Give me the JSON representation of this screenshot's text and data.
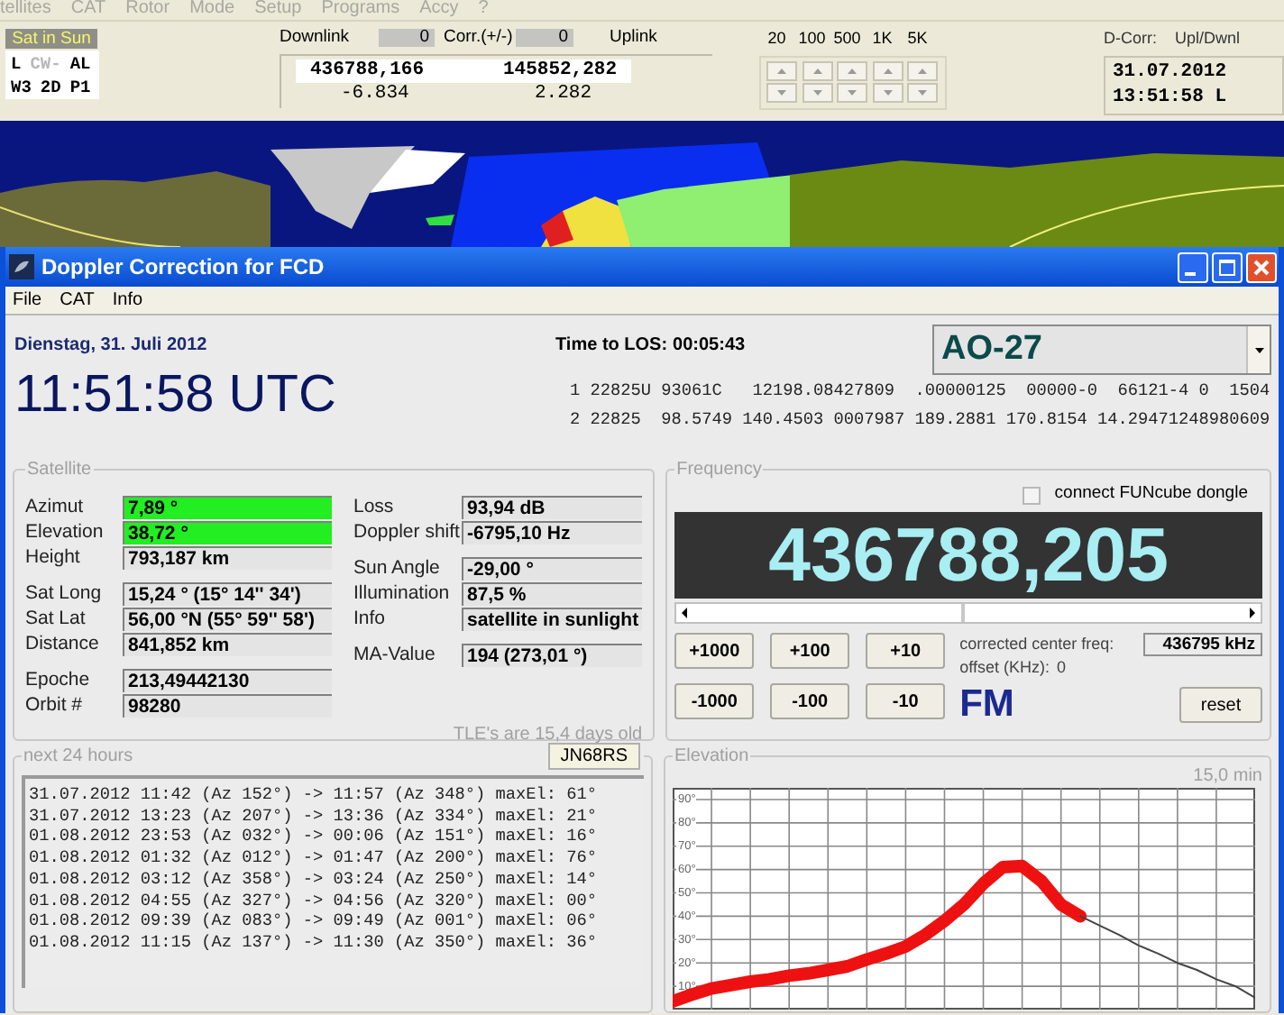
{
  "main_menu": [
    "tellites",
    "CAT",
    "Rotor",
    "Mode",
    "Setup",
    "Programs",
    "Accy",
    "?"
  ],
  "status_indicator": "Sat in Sun",
  "mode_flags": [
    [
      {
        "label": "L",
        "disabled": false
      },
      {
        "label": "CW-",
        "disabled": true
      },
      {
        "label": "AL",
        "disabled": false
      }
    ],
    [
      {
        "label": "W3",
        "disabled": false
      },
      {
        "label": "2D",
        "disabled": false
      },
      {
        "label": "P1",
        "disabled": false
      }
    ]
  ],
  "doppler_header": {
    "downlink_label": "Downlink",
    "downlink_value": "0",
    "corr_label": "Corr.(+/-)",
    "corr_value": "0",
    "uplink_label": "Uplink",
    "downlink_freq": "436788,166",
    "uplink_freq": "145852,282",
    "downlink_shift": "-6.834",
    "uplink_shift": "2.282"
  },
  "step_sizes": [
    "20",
    "100",
    "500",
    "1K",
    "5K"
  ],
  "clock": {
    "label": "D-Corr:",
    "mode": "Upl/Dwnl",
    "date": "31.07.2012",
    "time": "13:51:58 L"
  },
  "window": {
    "title": "Doppler Correction for FCD",
    "menu": [
      "File",
      "CAT",
      "Info"
    ],
    "date": "Dienstag, 31. Juli 2012",
    "time_utc": "11:51:58 UTC",
    "los_label": "Time to LOS:",
    "los": "00:05:43",
    "satellite_select": "AO-27",
    "tle_lines": [
      "1 22825U 93061C   12198.08427809  .00000125  00000-0  66121-4 0  1504",
      "2 22825  98.5749 140.4503 0007987 189.2881 170.8154 14.29471248980609"
    ]
  },
  "satellite": {
    "title": "Satellite",
    "left": [
      [
        {
          "label": "Azimut",
          "value": "7,89 °",
          "highlight": true
        },
        {
          "label": "Elevation",
          "value": "38,72 °",
          "highlight": true
        },
        {
          "label": "Height",
          "value": "793,187 km",
          "highlight": false
        }
      ],
      [
        {
          "label": "Sat Long",
          "value": "15,24 °  (15° 14'' 34')",
          "highlight": false
        },
        {
          "label": "Sat Lat",
          "value": "56,00 °N  (55° 59'' 58')",
          "highlight": false
        },
        {
          "label": "Distance",
          "value": "841,852 km",
          "highlight": false
        }
      ],
      [
        {
          "label": "Epoche",
          "value": "213,49442130",
          "highlight": false
        },
        {
          "label": "Orbit #",
          "value": "98280",
          "highlight": false
        }
      ]
    ],
    "right": [
      [
        {
          "label": "Loss",
          "value": "93,94 dB",
          "highlight": false
        },
        {
          "label": "Doppler shift",
          "value": "-6795,10 Hz",
          "highlight": false
        }
      ],
      [
        {
          "label": "Sun Angle",
          "value": "-29,00 °",
          "highlight": false
        },
        {
          "label": "Illumination",
          "value": "87,5 %",
          "highlight": false
        },
        {
          "label": "Info",
          "value": "satellite in sunlight",
          "highlight": false
        }
      ],
      [
        {
          "label": "MA-Value",
          "value": "194  (273,01 °)",
          "highlight": false
        }
      ]
    ],
    "tle_age": "TLE's are 15,4 days old"
  },
  "frequency": {
    "title": "Frequency",
    "dongle_label": "connect FUNcube dongle",
    "dongle_checked": false,
    "display": "436788,205",
    "step_buttons": [
      [
        "+1000",
        "+100",
        "+10"
      ],
      [
        "-1000",
        "-100",
        "-10"
      ]
    ],
    "center_label": "corrected center freq:",
    "center_value": "436795 kHz",
    "offset_label": "offset (KHz):",
    "offset_value": "0",
    "mode": "FM",
    "reset": "reset"
  },
  "next_passes": {
    "title": "next 24 hours",
    "locator": "JN68RS",
    "passes": [
      "31.07.2012 11:42 (Az 152°) -> 11:57 (Az 348°) maxEl: 61°",
      "31.07.2012 13:23 (Az 207°) -> 13:36 (Az 334°) maxEl: 21°",
      "01.08.2012 23:53 (Az 032°) -> 00:06 (Az 151°) maxEl: 16°",
      "01.08.2012 01:32 (Az 012°) -> 01:47 (Az 200°) maxEl: 76°",
      "01.08.2012 03:12 (Az 358°) -> 03:24 (Az 250°) maxEl: 14°",
      "01.08.2012 04:55 (Az 327°) -> 04:56 (Az 320°) maxEl: 00°",
      "01.08.2012 09:39 (Az 083°) -> 09:49 (Az 001°) maxEl: 06°",
      "01.08.2012 11:15 (Az 137°) -> 11:30 (Az 350°) maxEl: 36°"
    ]
  },
  "elevation": {
    "title": "Elevation",
    "duration": "15,0 min",
    "chart_data": {
      "type": "line",
      "ylim": [
        0,
        95
      ],
      "grid": true,
      "yticks": [
        {
          "value": 90,
          "label": "90°"
        },
        {
          "value": 80,
          "label": "80°"
        },
        {
          "value": 70,
          "label": "70°"
        },
        {
          "value": 60,
          "label": "60°"
        },
        {
          "value": 50,
          "label": "50°"
        },
        {
          "value": 40,
          "label": "40°"
        },
        {
          "value": 30,
          "label": "30°"
        },
        {
          "value": 20,
          "label": "20°"
        },
        {
          "value": 10,
          "label": "10°"
        }
      ],
      "categories": [
        null,
        null,
        null,
        null,
        null,
        null,
        null,
        null,
        null,
        null,
        null,
        null,
        null,
        null,
        null,
        null,
        null,
        null,
        null,
        null,
        null,
        null,
        null,
        null,
        null,
        null,
        null,
        null,
        null,
        null,
        null
      ],
      "series": [
        {
          "color": "#ee1111",
          "values": [
            3.5,
            6.5,
            9,
            10.5,
            12,
            13,
            14.5,
            15.5,
            17,
            18.5,
            21.5,
            24,
            27,
            32,
            38,
            45,
            54,
            61,
            61.5,
            55,
            45,
            40,
            null,
            null,
            null,
            null,
            null,
            null,
            null,
            null,
            null
          ]
        },
        {
          "color": "#444444",
          "values": [
            null,
            null,
            null,
            null,
            null,
            null,
            null,
            null,
            null,
            null,
            null,
            null,
            null,
            null,
            null,
            null,
            null,
            null,
            null,
            null,
            null,
            40,
            36,
            32,
            27.5,
            24,
            20,
            17,
            13,
            10,
            5
          ]
        }
      ]
    }
  }
}
